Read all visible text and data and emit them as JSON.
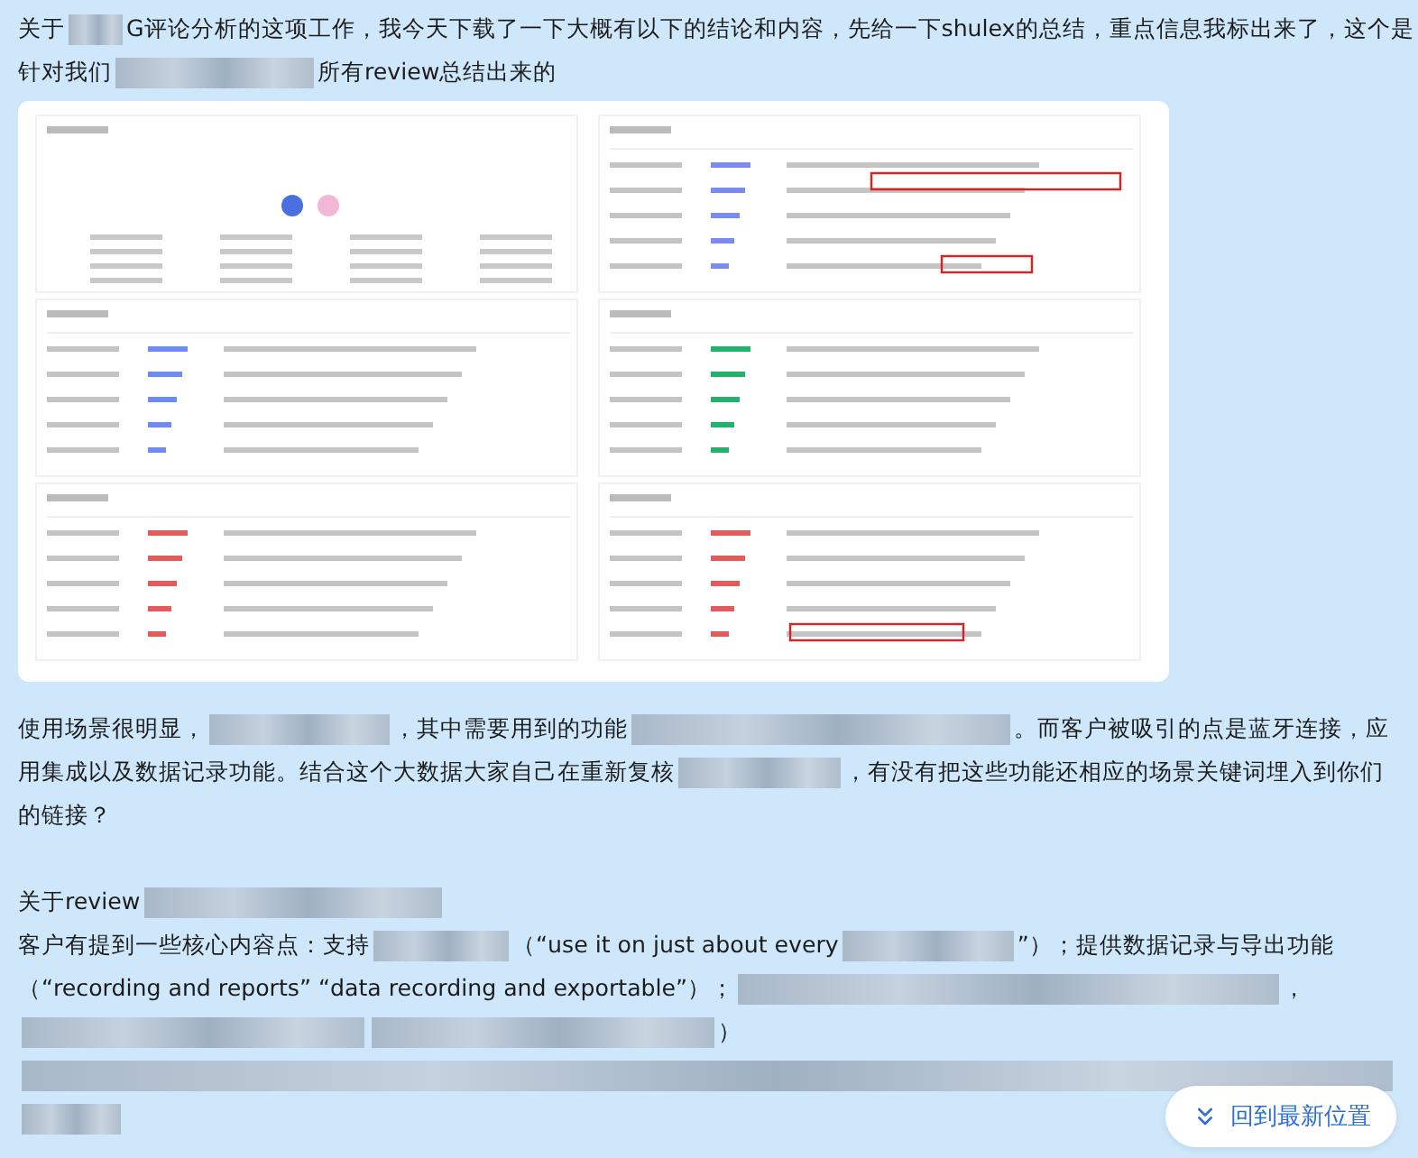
{
  "message": {
    "paragraphs": [
      {
        "lines": [
          [
            {
              "kind": "text",
              "text": "关于"
            },
            {
              "kind": "redacted"
            },
            {
              "kind": "text",
              "text": "G评论分析的这项工作，我今天下载了一下大概有以下的结论和内容，先给一下shulex的总结，重点信息我标出来了，这个是"
            }
          ],
          [
            {
              "kind": "text",
              "text": "针对我们"
            },
            {
              "kind": "redacted"
            },
            {
              "kind": "text",
              "text": "所有review总结出来的"
            }
          ]
        ]
      },
      {
        "lines": [
          [
            {
              "kind": "image"
            }
          ]
        ]
      },
      {
        "lines": [
          [
            {
              "kind": "text",
              "text": "使用场景很明显，"
            },
            {
              "kind": "redacted"
            },
            {
              "kind": "text",
              "text": "，其中需要用到的功能"
            },
            {
              "kind": "redacted"
            },
            {
              "kind": "text",
              "text": "。而客户被吸引的点是蓝牙连接，应"
            }
          ],
          [
            {
              "kind": "text",
              "text": "用集成以及数据记录功能。结合这个大数据大家自己在重新复核"
            },
            {
              "kind": "redacted"
            },
            {
              "kind": "text",
              "text": "，有没有把这些功能还相应的场景关键词埋入到你们"
            }
          ],
          [
            {
              "kind": "text",
              "text": "的链接？"
            }
          ]
        ]
      },
      {
        "lines": [
          [
            {
              "kind": "text",
              "text": "关于review"
            },
            {
              "kind": "redacted"
            }
          ]
        ]
      },
      {
        "lines": [
          [
            {
              "kind": "text",
              "text": "客户有提到一些核心内容点：支持"
            },
            {
              "kind": "redacted"
            },
            {
              "kind": "text",
              "text": "（“use it on just about every"
            },
            {
              "kind": "redacted"
            },
            {
              "kind": "text",
              "text": "”）；提供数据记录与导出功能"
            }
          ],
          [
            {
              "kind": "text",
              "text": "（“recording and reports” “data recording and exportable”）；"
            },
            {
              "kind": "redacted"
            },
            {
              "kind": "text",
              "text": "，"
            }
          ],
          [
            {
              "kind": "redacted"
            },
            {
              "kind": "redacted"
            },
            {
              "kind": "text",
              "text": "）"
            }
          ],
          [
            {
              "kind": "redacted"
            }
          ],
          [
            {
              "kind": "redacted"
            }
          ]
        ]
      }
    ]
  },
  "jump_button": {
    "label": "回到最新位置"
  }
}
